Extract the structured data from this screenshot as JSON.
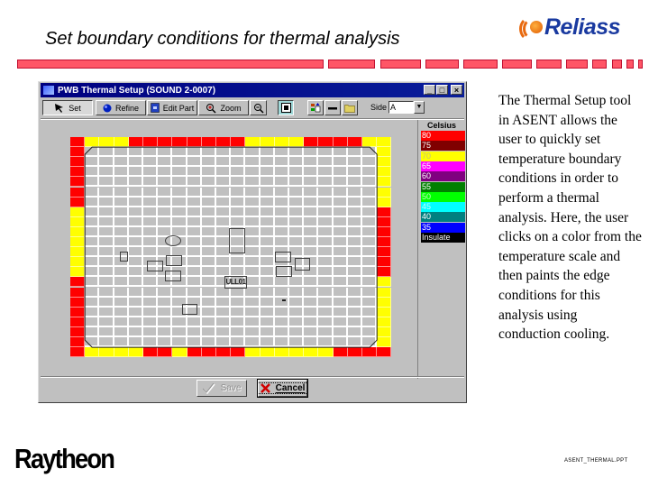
{
  "slide": {
    "title": "Set boundary conditions for thermal analysis",
    "logo_text": "Reliass",
    "body": "The Thermal Setup tool in ASENT allows the user to quickly set temperature boundary conditions in order to perform a thermal analysis. Here, the user clicks on a color from the temperature scale and then paints the edge conditions for this analysis using conduction cooling.",
    "footer_logo": "Raytheon",
    "footer_file": "ASENT_THERMAL.PPT",
    "accent_bar_color": "#ff5566"
  },
  "window": {
    "title": "PWB Thermal Setup (SOUND  2-0007)",
    "controls": {
      "minimize": "_",
      "maximize": "□",
      "close": "×"
    },
    "toolbar": {
      "set": "Set",
      "refine": "Refine",
      "edit_part": "Edit Part",
      "zoom": "Zoom",
      "side_label": "Side",
      "side_value": "A"
    },
    "buttons": {
      "save": "Save",
      "cancel": "Cancel"
    }
  },
  "legend": {
    "header": "Celsius",
    "items": [
      {
        "label": "80",
        "color": "#ff0000",
        "text": "#ffffff"
      },
      {
        "label": "75",
        "color": "#800000",
        "text": "#ffffff"
      },
      {
        "label": "70",
        "color": "#ffff00",
        "text": "#c0c080"
      },
      {
        "label": "65",
        "color": "#ff00ff",
        "text": "#ffffff"
      },
      {
        "label": "60",
        "color": "#800080",
        "text": "#ffffff"
      },
      {
        "label": "55",
        "color": "#008000",
        "text": "#ffffff"
      },
      {
        "label": "50",
        "color": "#00ff00",
        "text": "#c0ffc0"
      },
      {
        "label": "45",
        "color": "#00ffff",
        "text": "#c0ffff"
      },
      {
        "label": "40",
        "color": "#008080",
        "text": "#ffffff"
      },
      {
        "label": "35",
        "color": "#0000ff",
        "text": "#ffffff"
      },
      {
        "label": "Insulate",
        "color": "#000000",
        "text": "#ffffff"
      }
    ]
  },
  "grid": {
    "cols": 22,
    "rows": 22,
    "edge_colors": {
      "R": "#ff0000",
      "Y": "#ffff00"
    },
    "top": "RYYYRRRRRRRRYYYYRRRRYY",
    "bottom": "RYYYYRRYRRRRYYYYYYRRRR",
    "left": "RRRRRRRYYYYYYYRRRRRRRR",
    "right": "YYYYYYYRRRRRRRYYYYYYYR"
  },
  "components": [
    {
      "kind": "ellipse",
      "label": ""
    },
    {
      "kind": "rect",
      "label": ""
    },
    {
      "kind": "rect",
      "label": ""
    },
    {
      "kind": "rect",
      "label": ""
    },
    {
      "kind": "rect",
      "label": ""
    },
    {
      "kind": "rect",
      "label": ""
    },
    {
      "kind": "rect",
      "label": "ULL01"
    },
    {
      "kind": "rect",
      "label": ""
    },
    {
      "kind": "rect",
      "label": ""
    },
    {
      "kind": "rect",
      "label": ""
    },
    {
      "kind": "dash",
      "label": ""
    },
    {
      "kind": "rect",
      "label": ""
    }
  ]
}
